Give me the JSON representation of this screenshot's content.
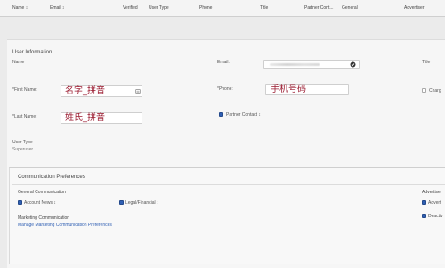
{
  "header": {
    "columns": [
      {
        "label": "Name",
        "sort": "↕"
      },
      {
        "label": "Email",
        "sort": "↕"
      },
      {
        "label": "Verified",
        "sort": ""
      },
      {
        "label": "User Type",
        "sort": ""
      },
      {
        "label": "Phone",
        "sort": ""
      },
      {
        "label": "Title",
        "sort": ""
      },
      {
        "label": "Partner Cont...",
        "sort": ""
      },
      {
        "label": "General",
        "sort": ""
      },
      {
        "label": "Advertiser",
        "sort": ""
      }
    ]
  },
  "user_info": {
    "section_title": "User Information",
    "name_label": "Name",
    "first_name_label": "*First Name:",
    "first_name_value": "名字_拼音",
    "last_name_label": "*Last Name:",
    "last_name_value": "姓氏_拼音",
    "email_label": "Email:",
    "phone_label": "*Phone:",
    "phone_value": "手机号码",
    "partner_contact_label": "Partner Contact",
    "partner_contact_help": "↕",
    "user_type_label": "User Type",
    "user_type_value": "Superuser",
    "right_label_1": "Charg",
    "right_column_label": "Title"
  },
  "comm_prefs": {
    "section_title": "Communication Preferences",
    "general_title": "General Communication",
    "account_news_label": "Account News",
    "account_news_help": "↕",
    "legal_label": "Legal/Financial",
    "legal_help": "↕",
    "marketing_title": "Marketing Communication",
    "manage_link": "Manage Marketing Communication Preferences",
    "advertise_title": "Advertise",
    "advert_item_1": "Advert",
    "advert_item_2": "Deactiv"
  },
  "colors": {
    "accent": "#2f5fb3",
    "cjk_text": "#9b1b30"
  }
}
